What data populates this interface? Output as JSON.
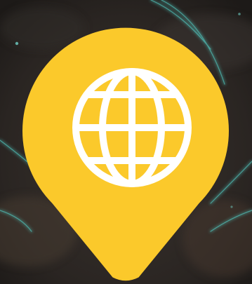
{
  "colors": {
    "pin": "#fbc92b",
    "globe": "#ffffff",
    "background": "#2a2624",
    "glow_lines": "#4fb8b0"
  },
  "graphic": {
    "marker_icon": "map-pin-icon",
    "inner_icon": "globe-icon"
  }
}
